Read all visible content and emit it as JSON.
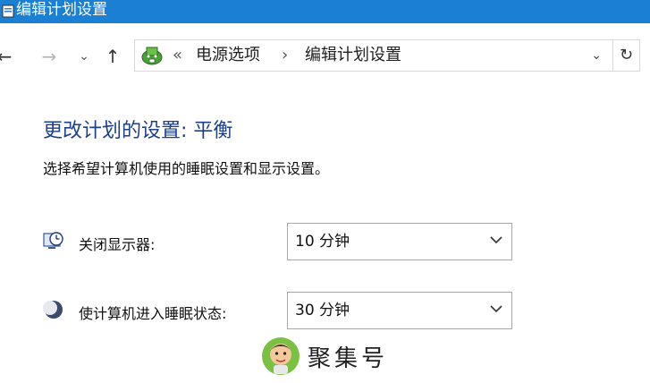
{
  "window": {
    "title": "编辑计划设置",
    "title_bar_color": "#1b7fd4"
  },
  "nav": {
    "back_glyph": "←",
    "forward_glyph": "→",
    "recent_glyph": "⌄",
    "up_glyph": "↑",
    "refresh_glyph": "↻"
  },
  "address_bar": {
    "location_icon": "power-options-icon",
    "overflow_sep": "«",
    "crumbs": [
      "电源选项",
      "编辑计划设置"
    ],
    "separator": "›",
    "dropdown_glyph": "⌄"
  },
  "main": {
    "heading": "更改计划的设置: 平衡",
    "subtext": "选择希望计算机使用的睡眠设置和显示设置。",
    "heading_color": "#1e3f8a",
    "settings": [
      {
        "icon": "display-clock-icon",
        "label": "关闭显示器:",
        "value": "10 分钟"
      },
      {
        "icon": "sleep-moon-icon",
        "label": "使计算机进入睡眠状态:",
        "value": "30 分钟"
      }
    ]
  },
  "watermark": {
    "icon": "cartoon-avatar-icon",
    "text": "聚集号"
  }
}
